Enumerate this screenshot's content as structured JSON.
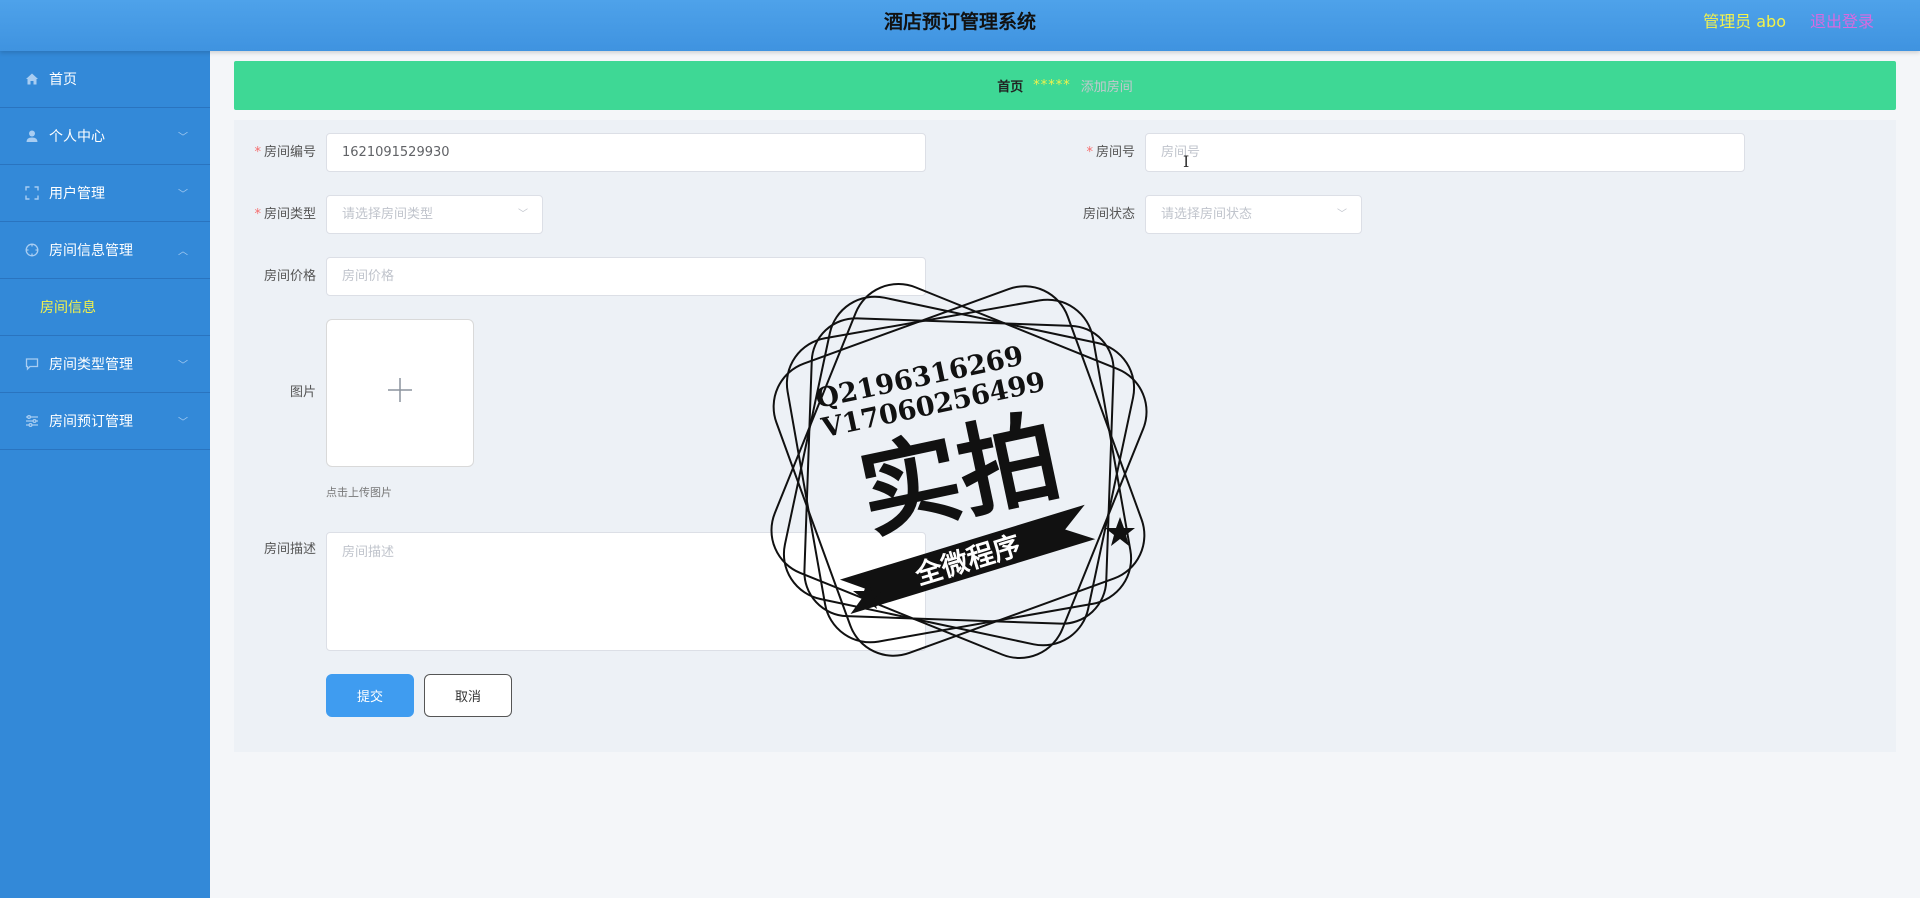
{
  "header": {
    "title": "酒店预订管理系统",
    "admin": "管理员 abo",
    "logout": "退出登录"
  },
  "sidebar": {
    "items": [
      {
        "label": "首页",
        "icon": "home-icon"
      },
      {
        "label": "个人中心",
        "icon": "user-icon"
      },
      {
        "label": "用户管理",
        "icon": "fullscreen-icon"
      },
      {
        "label": "房间信息管理",
        "icon": "compass-icon",
        "sub": "房间信息"
      },
      {
        "label": "房间类型管理",
        "icon": "chat-icon"
      },
      {
        "label": "房间预订管理",
        "icon": "sliders-icon"
      }
    ]
  },
  "breadcrumb": {
    "home": "首页",
    "sep": "*****",
    "current": "添加房间"
  },
  "form": {
    "room_code_label": "房间编号",
    "room_code_value": "1621091529930",
    "room_no_label": "房间号",
    "room_no_placeholder": "房间号",
    "room_type_label": "房间类型",
    "room_type_placeholder": "请选择房间类型",
    "room_status_label": "房间状态",
    "room_status_placeholder": "请选择房间状态",
    "room_price_label": "房间价格",
    "room_price_placeholder": "房间价格",
    "image_label": "图片",
    "upload_hint": "点击上传图片",
    "desc_label": "房间描述",
    "desc_placeholder": "房间描述",
    "submit": "提交",
    "cancel": "取消"
  },
  "watermark": {
    "line1": "Q2196316269",
    "line2": "V17060256499",
    "main": "实拍",
    "banner": "全微程序"
  },
  "colors": {
    "header": "#4ea2ea",
    "sidebar": "#3389d8",
    "breadcrumb": "#3ed895",
    "primary_button": "#3f9cf0",
    "required": "#f56c6c"
  }
}
